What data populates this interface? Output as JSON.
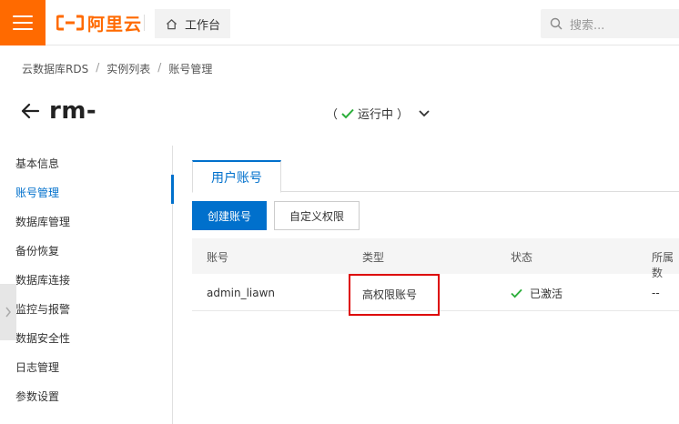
{
  "header": {
    "brand": "阿里云",
    "workbench_label": "工作台",
    "search_placeholder": "搜索..."
  },
  "breadcrumb": [
    "云数据库RDS",
    "实例列表",
    "账号管理"
  ],
  "instance": {
    "title": "rm-",
    "status_open": "（",
    "status_text": "运行中",
    "status_close": "）"
  },
  "sidebar": {
    "items": [
      {
        "label": "基本信息"
      },
      {
        "label": "账号管理"
      },
      {
        "label": "数据库管理"
      },
      {
        "label": "备份恢复"
      },
      {
        "label": "数据库连接"
      },
      {
        "label": "监控与报警"
      },
      {
        "label": "数据安全性"
      },
      {
        "label": "日志管理"
      },
      {
        "label": "参数设置"
      }
    ],
    "active_index": 1
  },
  "main": {
    "tab_label": "用户账号",
    "create_button": "创建账号",
    "custom_perm_button": "自定义权限",
    "table": {
      "columns": [
        "账号",
        "类型",
        "状态",
        "所属数"
      ],
      "rows": [
        {
          "account": "admin_liawn",
          "type": "高权限账号",
          "status": "已激活",
          "db": "--"
        }
      ]
    }
  },
  "colors": {
    "brand": "#ff6a00",
    "primary": "#0070cc",
    "success": "#2bae3a",
    "highlight": "#dd0000"
  }
}
